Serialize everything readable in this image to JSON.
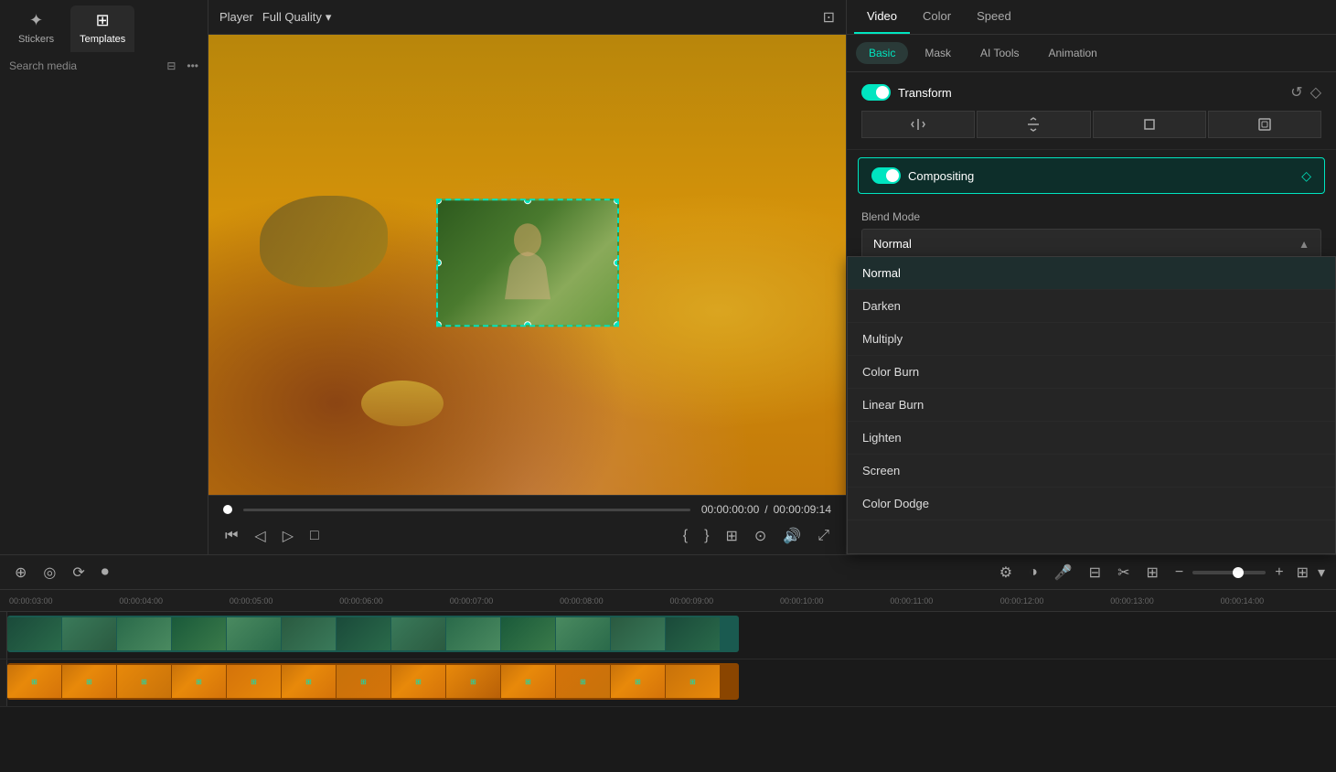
{
  "sidebar": {
    "tabs": [
      {
        "id": "stickers",
        "label": "Stickers",
        "icon": "✦"
      },
      {
        "id": "templates",
        "label": "Templates",
        "icon": "⊞"
      }
    ],
    "active_tab": "templates",
    "search_placeholder": "Search media",
    "filter_icon": "⊟",
    "more_icon": "•••"
  },
  "player": {
    "label": "Player",
    "quality": "Full Quality",
    "quality_arrow": "▾",
    "frame_icon": "⊡",
    "progress_time": "00:00:00:00",
    "total_time": "00:00:09:14",
    "controls": {
      "back": "⏮",
      "prev_frame": "◁",
      "play": "▷",
      "stop": "□",
      "mark_in": "{",
      "mark_out": "}",
      "fullscreen": "⊞",
      "screenshot": "⊙",
      "volume": "🔊",
      "expand": "⤢"
    }
  },
  "right_panel": {
    "tabs": [
      "Video",
      "Color",
      "Speed"
    ],
    "active_tab": "Video",
    "sub_tabs": [
      "Basic",
      "Mask",
      "AI Tools",
      "Animation"
    ],
    "active_sub_tab": "Basic",
    "transform": {
      "label": "Transform",
      "enabled": true,
      "reset_icon": "↺",
      "diamond_icon": "◇",
      "icons": [
        "⟨/⟩",
        "⇒",
        "□",
        "▭"
      ]
    },
    "compositing": {
      "label": "Compositing",
      "enabled": true,
      "diamond_icon": "◇"
    },
    "blend_mode": {
      "label": "Blend Mode",
      "selected": "Normal",
      "options": [
        "Normal",
        "Darken",
        "Multiply",
        "Color Burn",
        "Linear Burn",
        "Lighten",
        "Screen",
        "Color Dodge"
      ]
    }
  },
  "timeline": {
    "toolbar_buttons": [
      "⊕",
      "◎",
      "⟳",
      "⏺"
    ],
    "zoom_minus": "−",
    "zoom_plus": "+",
    "ruler_marks": [
      "00:00:03:00",
      "00:00:04:00",
      "00:00:05:00",
      "00:00:06:00",
      "00:00:07:00",
      "00:00:08:00",
      "00:00:09:00",
      "00:00:10:00",
      "00:00:11:00",
      "00:00:12:00",
      "00:00:13:00",
      "00:00:14:00"
    ],
    "tracks": [
      {
        "id": "track1",
        "type": "video"
      },
      {
        "id": "track2",
        "type": "video"
      }
    ]
  }
}
